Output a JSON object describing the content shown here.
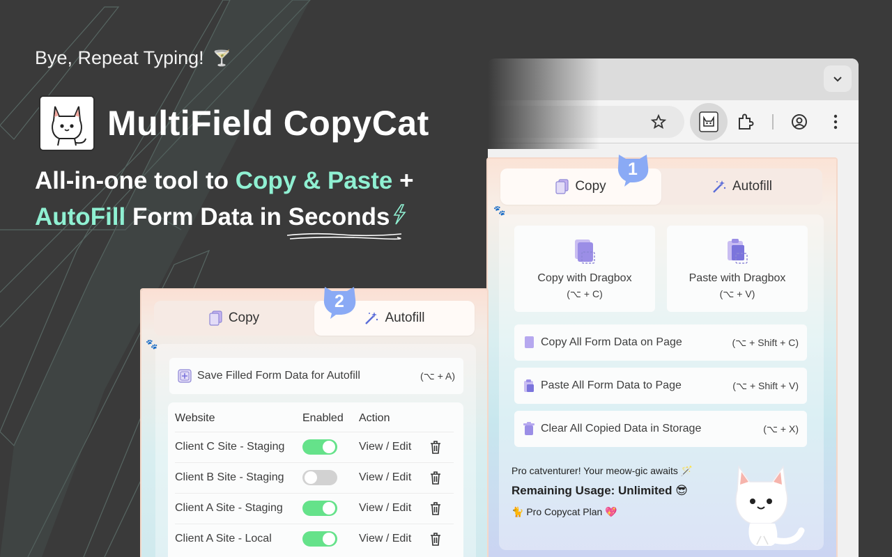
{
  "hero": {
    "tagline": "Bye, Repeat Typing!",
    "tagline_emoji": "🍸",
    "brand_name": "MultiField CopyCat",
    "headline_l1_a": "All-in-one tool to ",
    "headline_l1_b": "Copy & Paste",
    "headline_l1_c": " +",
    "headline_l2_a": "AutoFill",
    "headline_l2_b": " Form Data in ",
    "headline_l2_c": "Seconds"
  },
  "popup1": {
    "badge": "1",
    "tabs": [
      {
        "label": "Copy"
      },
      {
        "label": "Autofill"
      }
    ],
    "dragbox": [
      {
        "title": "Copy with Dragbox",
        "shortcut": "(⌥ + C)"
      },
      {
        "title": "Paste with Dragbox",
        "shortcut": "(⌥ + V)"
      }
    ],
    "actions": [
      {
        "label": "Copy All Form Data on Page",
        "shortcut": "(⌥ + Shift + C)"
      },
      {
        "label": "Paste All Form Data to Page",
        "shortcut": "(⌥ + Shift + V)"
      },
      {
        "label": "Clear All Copied Data in Storage",
        "shortcut": "(⌥ + X)"
      }
    ],
    "promo": {
      "line1": "Pro catventurer! Your meow-gic awaits 🪄",
      "line2": "Remaining Usage: Unlimited 😎",
      "line3": "🐈 Pro Copycat Plan 💖"
    }
  },
  "popup2": {
    "badge": "2",
    "tabs": [
      {
        "label": "Copy"
      },
      {
        "label": "Autofill"
      }
    ],
    "save": {
      "label": "Save Filled Form Data for Autofill",
      "shortcut": "(⌥ + A)"
    },
    "table": {
      "headers": [
        "Website",
        "Enabled",
        "Action"
      ],
      "rows": [
        {
          "website": "Client C Site - Staging",
          "enabled": true,
          "action": "View / Edit"
        },
        {
          "website": "Client B Site - Staging",
          "enabled": false,
          "action": "View / Edit"
        },
        {
          "website": "Client A Site - Staging",
          "enabled": true,
          "action": "View / Edit"
        },
        {
          "website": "Client A Site - Local",
          "enabled": true,
          "action": "View / Edit"
        }
      ]
    }
  },
  "colors": {
    "accent": "#8ff0d2",
    "badge": "#8aaaf5",
    "toggle_on": "#65e28a",
    "background": "#3a3a3a"
  },
  "icons": [
    "cat-logo-icon",
    "star-icon",
    "puzzle-icon",
    "account-icon",
    "kebab-menu-icon",
    "chevron-down-icon",
    "copy-icon",
    "magic-wand-icon",
    "paw-icon",
    "trash-icon",
    "plus-square-icon"
  ]
}
